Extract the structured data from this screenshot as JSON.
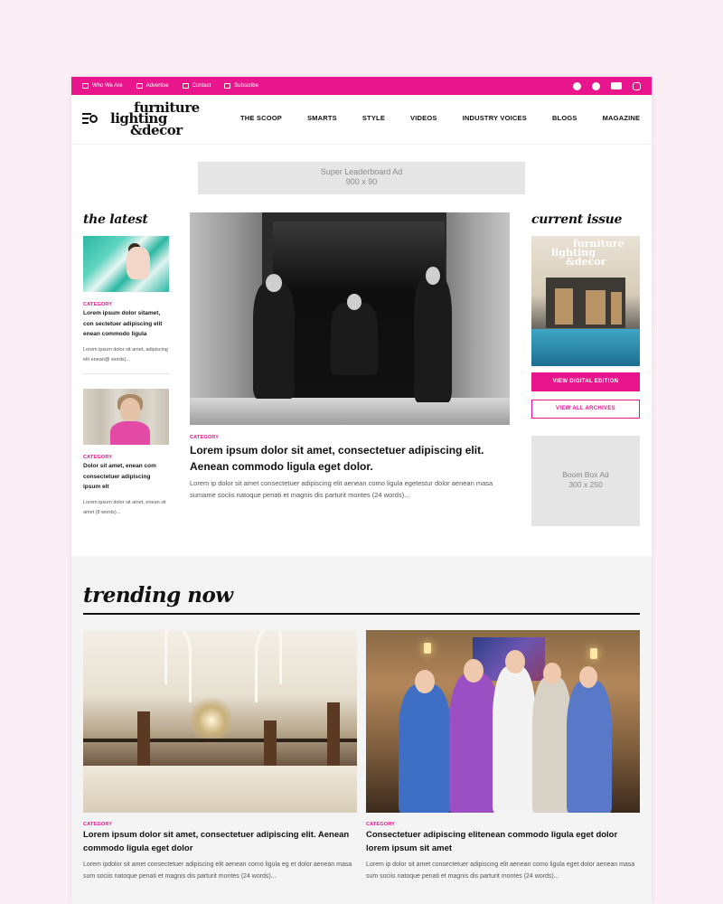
{
  "topbar": {
    "links": [
      {
        "label": "Who We Are",
        "icon": "people-icon"
      },
      {
        "label": "Advertise",
        "icon": "megaphone-icon"
      },
      {
        "label": "Contact",
        "icon": "document-icon"
      },
      {
        "label": "Subscribe",
        "icon": "mail-icon"
      }
    ],
    "social": [
      "facebook-icon",
      "pinterest-icon",
      "youtube-icon",
      "instagram-icon"
    ],
    "color": "#e8158c"
  },
  "logo": {
    "line1": "furniture",
    "line2": "lighting",
    "line3": "&decor"
  },
  "nav": [
    "THE SCOOP",
    "SMARTS",
    "STYLE",
    "VIDEOS",
    "INDUSTRY VOICES",
    "BLOGS",
    "MAGAZINE"
  ],
  "leaderboard_ad": {
    "line1": "Super Leaderboard Ad",
    "line2": "900 x 90"
  },
  "latest": {
    "title": "the latest",
    "items": [
      {
        "category": "CATEGORY",
        "headline": "Lorem ipsum dolor sitamet, con sectetuer adipiscing elit enean commodo ligula",
        "excerpt": "Lorem ipsum dolor sit amet, adipiscing elit enean@ words)..."
      },
      {
        "category": "CATEGORY",
        "headline": "Dolor sit amet, enean com consectetuer adipiscing ipsum elt",
        "excerpt": "Lorem ipsum dolor sit amet, enean sit amet (8 words)..."
      }
    ]
  },
  "feature": {
    "category": "CATEGORY",
    "headline": "Lorem ipsum dolor sit amet, consectetuer adipiscing elit. Aenean commodo ligula eget dolor.",
    "excerpt": "Lorem ip dolor sit amet consectetuer adipiscing elit aenean como ligula egetestur dolor aenean masa sumame sociis natoque penati et magnis dis parturit montes (24 words)..."
  },
  "current_issue": {
    "title": "current issue",
    "cover_logo": [
      "furniture",
      "lighting",
      "&decor"
    ],
    "primary_button": "VIEW DIGITAL EDITION",
    "secondary_button": "VIEW ALL ARCHIVES"
  },
  "boom_ad": {
    "line1": "Boom Box Ad",
    "line2": "300 x 250"
  },
  "trending": {
    "title": "trending now",
    "items": [
      {
        "category": "CATEGORY",
        "headline": "Lorem ipsum dolor sit amet, consectetuer adipiscing elit. Aenean commodo ligula eget dolor",
        "excerpt": "Lorem ipdolor sit amet consectetuer adipiscing elit aenean como ligula eg et dolor aenean masa sum sociis natoque penati et magnis dis parturit montes (24 words)..."
      },
      {
        "category": "CATEGORY",
        "headline": "Consectetuer adipiscing elitenean commodo ligula eget dolor lorem ipsum sit amet",
        "excerpt": "Lorem ip dolor sit amet consectetuer adipiscing elit aenean como ligula eget dolor aenean masa sum sociis natoque penati et magnis dis parturit montes (24 words)..."
      }
    ]
  }
}
